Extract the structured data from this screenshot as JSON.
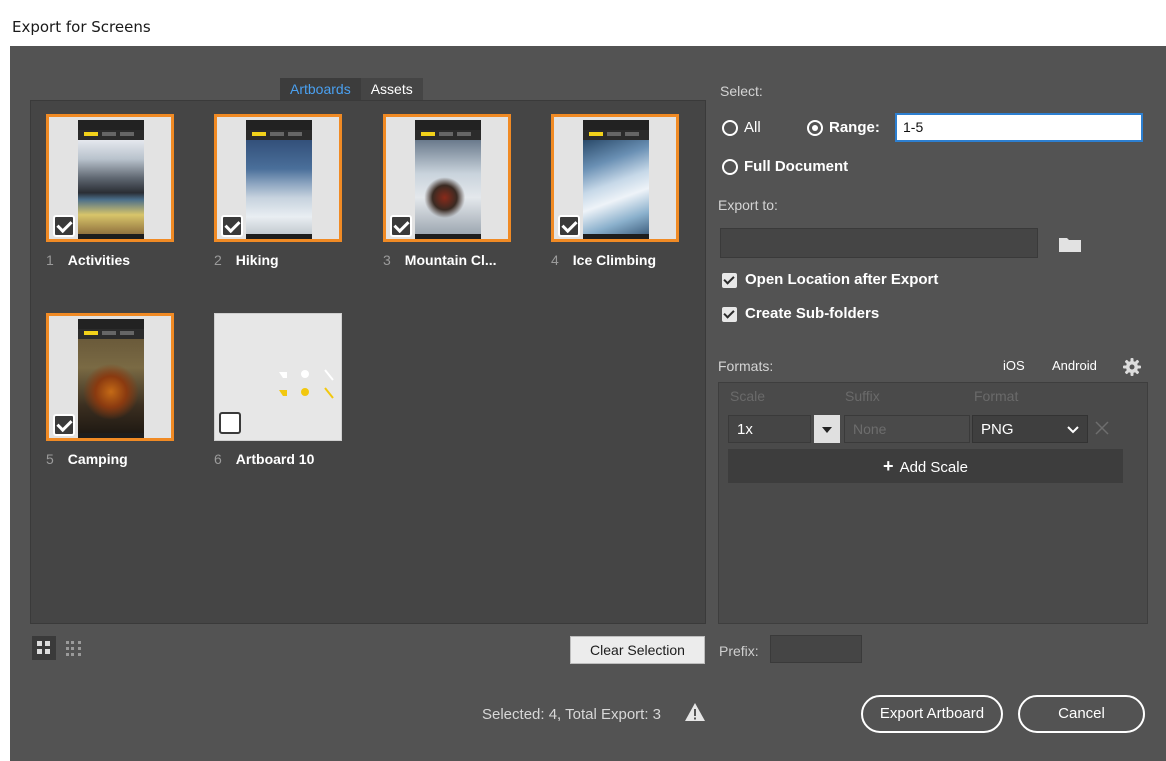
{
  "window": {
    "title": "Export for Screens"
  },
  "tabs": [
    {
      "label": "Artboards",
      "active": true
    },
    {
      "label": "Assets",
      "active": false
    }
  ],
  "artboards": [
    {
      "num": "1",
      "name": "Activities",
      "selected": true
    },
    {
      "num": "2",
      "name": "Hiking",
      "selected": true
    },
    {
      "num": "3",
      "name": "Mountain Cl...",
      "selected": true
    },
    {
      "num": "4",
      "name": "Ice Climbing",
      "selected": true
    },
    {
      "num": "5",
      "name": "Camping",
      "selected": true
    },
    {
      "num": "6",
      "name": "Artboard 10",
      "selected": false
    }
  ],
  "footer": {
    "clear_selection": "Clear Selection",
    "prefix_label": "Prefix:",
    "status": "Selected: 4, Total Export: 3",
    "export_button": "Export Artboard",
    "cancel_button": "Cancel"
  },
  "select": {
    "label": "Select:",
    "all": "All",
    "range": "Range:",
    "range_value": "1-5",
    "full_document": "Full Document",
    "selected_option": "Range"
  },
  "export_to": {
    "label": "Export to:",
    "path": "",
    "open_location": "Open Location after Export",
    "create_subfolders": "Create Sub-folders"
  },
  "formats": {
    "label": "Formats:",
    "ios": "iOS",
    "android": "Android",
    "headers": {
      "scale": "Scale",
      "suffix": "Suffix",
      "format": "Format"
    },
    "row": {
      "scale": "1x",
      "suffix_placeholder": "None",
      "format": "PNG"
    },
    "add_scale": "Add Scale"
  },
  "colors": {
    "background": "#535353",
    "panel": "#454545",
    "selection_border": "#f08a24",
    "active_tab_text": "#4aa0f0",
    "range_focus": "#2d7fd0"
  }
}
